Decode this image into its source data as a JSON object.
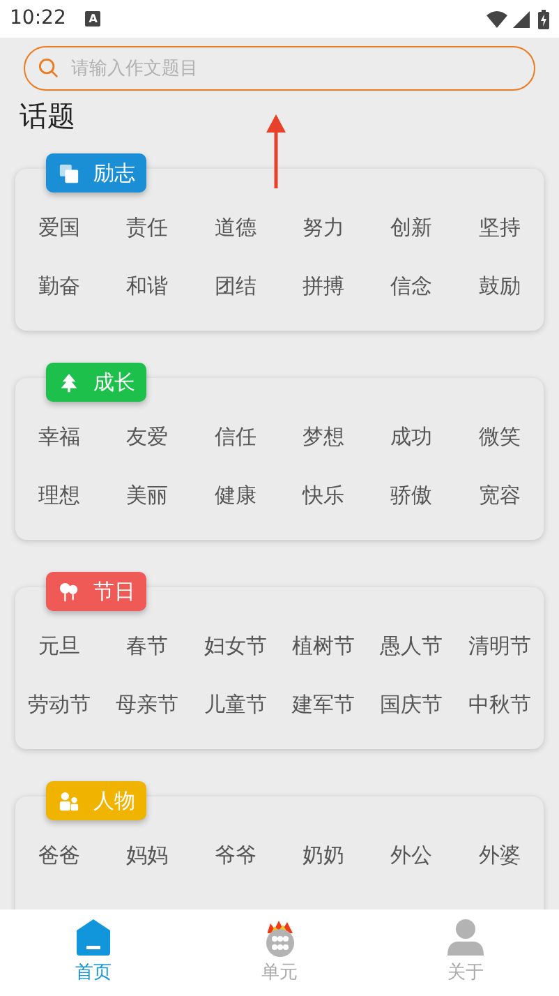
{
  "status_bar": {
    "time": "10:22",
    "notification": "A"
  },
  "search": {
    "placeholder": "请输入作文题目"
  },
  "section_title": "话题",
  "categories": [
    {
      "label": "励志",
      "color": "#1a8fd6",
      "topics": [
        "爱国",
        "责任",
        "道德",
        "努力",
        "创新",
        "坚持",
        "勤奋",
        "和谐",
        "团结",
        "拼搏",
        "信念",
        "鼓励"
      ]
    },
    {
      "label": "成长",
      "color": "#1cc04a",
      "topics": [
        "幸福",
        "友爱",
        "信任",
        "梦想",
        "成功",
        "微笑",
        "理想",
        "美丽",
        "健康",
        "快乐",
        "骄傲",
        "宽容"
      ]
    },
    {
      "label": "节日",
      "color": "#ef5a56",
      "topics": [
        "元旦",
        "春节",
        "妇女节",
        "植树节",
        "愚人节",
        "清明节",
        "劳动节",
        "母亲节",
        "儿童节",
        "建军节",
        "国庆节",
        "中秋节"
      ]
    },
    {
      "label": "人物",
      "color": "#f0b400",
      "topics": [
        "爸爸",
        "妈妈",
        "爷爷",
        "奶奶",
        "外公",
        "外婆"
      ]
    }
  ],
  "tabs": [
    {
      "label": "首页",
      "selected": true
    },
    {
      "label": "单元",
      "selected": false
    },
    {
      "label": "关于",
      "selected": false
    }
  ]
}
